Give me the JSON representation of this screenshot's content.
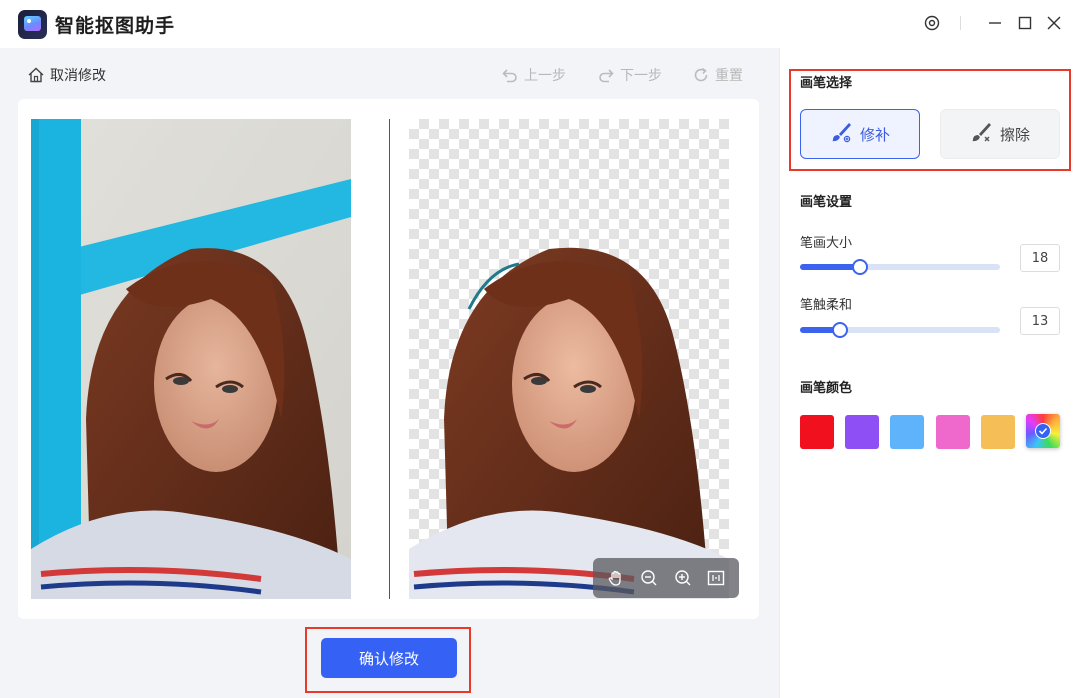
{
  "app": {
    "title": "智能抠图助手"
  },
  "toolbar": {
    "cancel_label": "取消修改",
    "undo_label": "上一步",
    "redo_label": "下一步",
    "reset_label": "重置"
  },
  "confirm_label": "确认修改",
  "panel": {
    "brush_select_title": "画笔选择",
    "brush_options": [
      {
        "label": "修补",
        "selected": true
      },
      {
        "label": "擦除",
        "selected": false
      }
    ],
    "brush_settings_title": "画笔设置",
    "sliders": [
      {
        "label": "笔画大小",
        "value": "18",
        "fill": 0.3
      },
      {
        "label": "笔触柔和",
        "value": "13",
        "fill": 0.2
      }
    ],
    "brush_color_title": "画笔颜色",
    "colors": [
      "#f0101e",
      "#8e4ff5",
      "#5eb3fa",
      "#ef69cc",
      "#f5be56"
    ],
    "accent_color": "#3661f5"
  },
  "icons": {
    "settings": "gear-icon",
    "minimize": "minimize-icon",
    "maximize": "maximize-icon",
    "close": "close-icon",
    "home": "home-icon",
    "undo": "undo-icon",
    "redo": "redo-icon",
    "reset": "reset-icon",
    "hand": "hand-icon",
    "zoom_out": "zoom-out-icon",
    "zoom_in": "zoom-in-icon",
    "fit": "fit-icon"
  }
}
